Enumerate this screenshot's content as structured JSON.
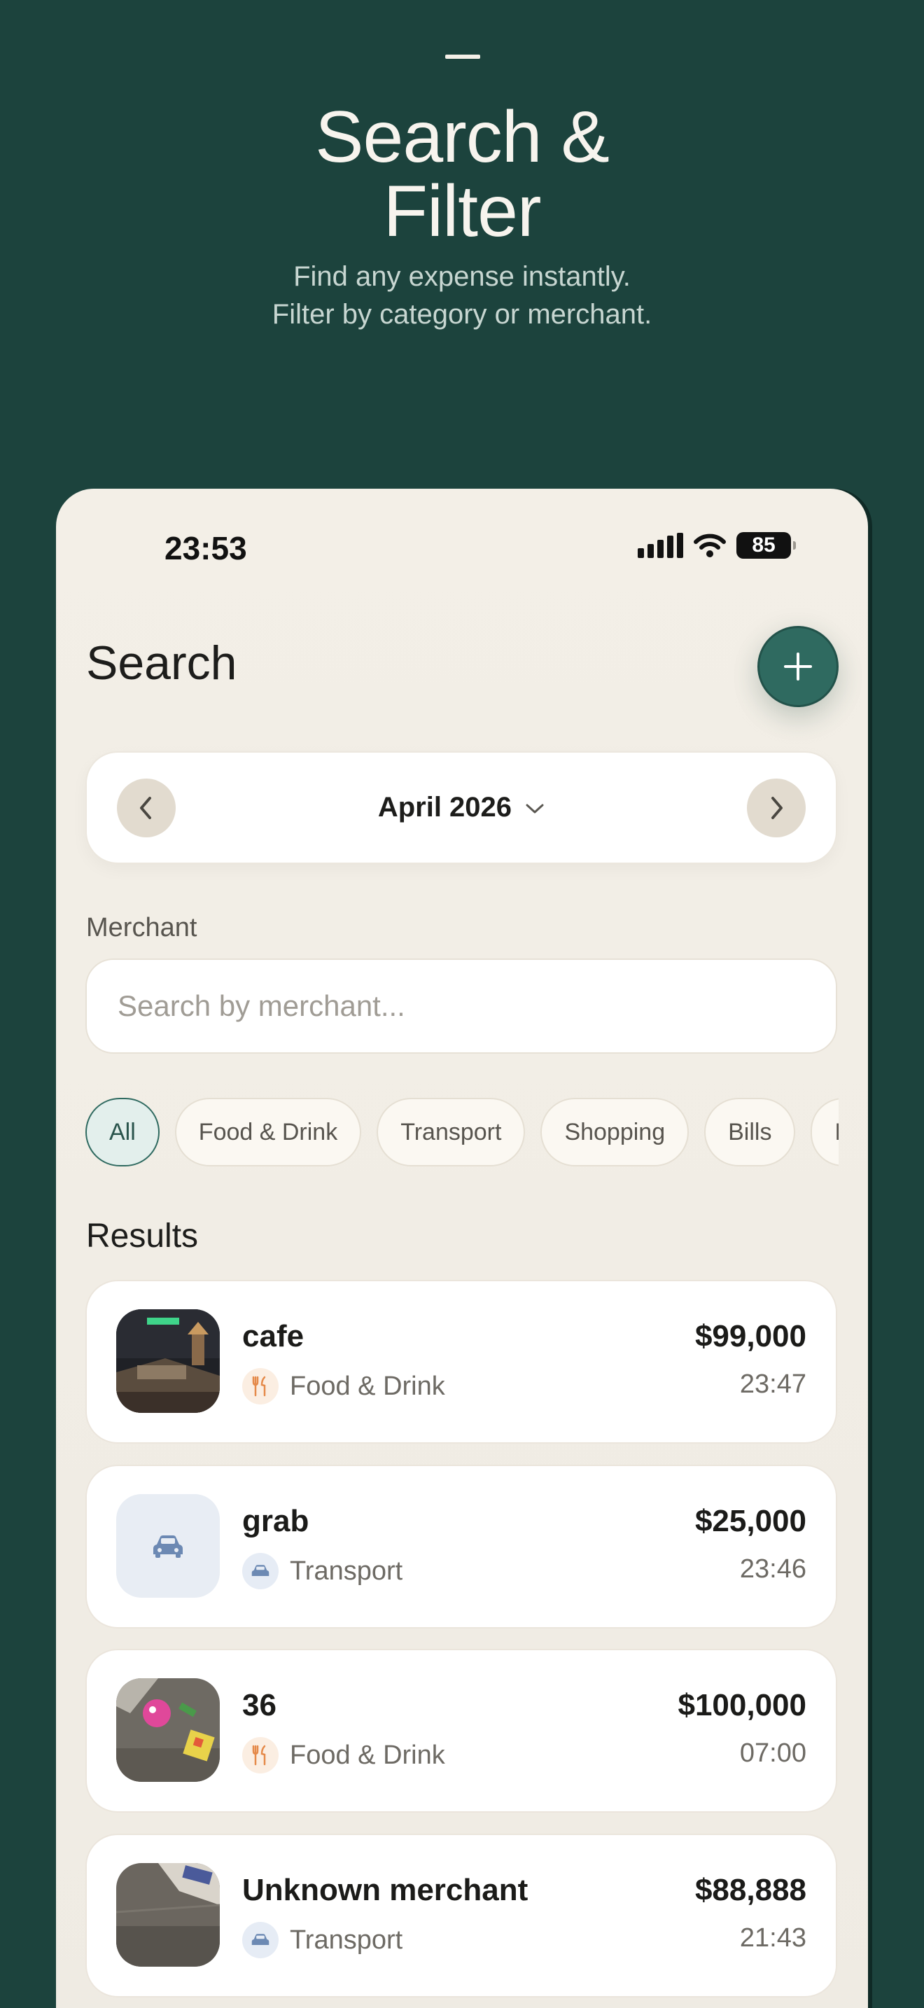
{
  "hero": {
    "title_line1": "Search &",
    "title_line2": "Filter",
    "subtitle_line1": "Find any expense instantly.",
    "subtitle_line2": "Filter by category or merchant."
  },
  "status_bar": {
    "time": "23:53",
    "battery": "85"
  },
  "header": {
    "title": "Search",
    "add_icon": "plus-icon"
  },
  "month_selector": {
    "label": "April 2026",
    "prev_icon": "chevron-left-icon",
    "next_icon": "chevron-right-icon",
    "dropdown_icon": "chevron-down-icon"
  },
  "merchant_filter": {
    "label": "Merchant",
    "placeholder": "Search by merchant...",
    "value": ""
  },
  "category_chips": [
    {
      "label": "All",
      "active": true
    },
    {
      "label": "Food & Drink",
      "active": false
    },
    {
      "label": "Transport",
      "active": false
    },
    {
      "label": "Shopping",
      "active": false
    },
    {
      "label": "Bills",
      "active": false
    },
    {
      "label": "H",
      "active": false
    }
  ],
  "results": {
    "label": "Results",
    "items": [
      {
        "merchant": "cafe",
        "category": "Food & Drink",
        "category_icon": "utensils-icon",
        "amount": "$99,000",
        "time": "23:47",
        "thumb": "photo-night-city"
      },
      {
        "merchant": "grab",
        "category": "Transport",
        "category_icon": "car-icon",
        "amount": "$25,000",
        "time": "23:46",
        "thumb": "car-icon"
      },
      {
        "merchant": "36",
        "category": "Food & Drink",
        "category_icon": "utensils-icon",
        "amount": "$100,000",
        "time": "07:00",
        "thumb": "photo-desk-toys"
      },
      {
        "merchant": "Unknown merchant",
        "category": "Transport",
        "category_icon": "car-icon",
        "amount": "$88,888",
        "time": "21:43",
        "thumb": "photo-desk-device"
      }
    ]
  },
  "colors": {
    "background": "#1c433d",
    "accent": "#2f6a60",
    "card": "#ffffff",
    "surface": "#f3efe7"
  }
}
